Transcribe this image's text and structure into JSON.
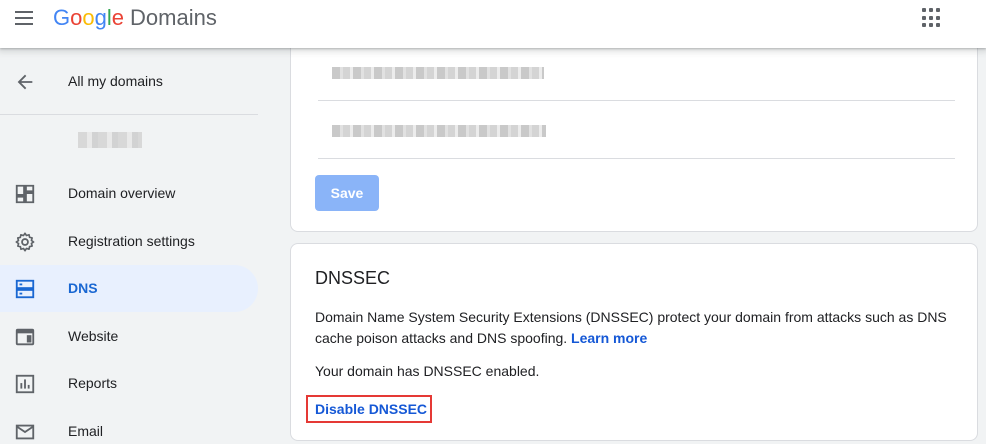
{
  "header": {
    "logo_parts": [
      "G",
      "o",
      "o",
      "g",
      "l",
      "e"
    ],
    "product": "Domains"
  },
  "sidebar": {
    "back_label": "All my domains",
    "items": [
      {
        "label": "Domain overview",
        "icon": "dashboard-icon",
        "active": false
      },
      {
        "label": "Registration settings",
        "icon": "gear-icon",
        "active": false
      },
      {
        "label": "DNS",
        "icon": "dns-icon",
        "active": true
      },
      {
        "label": "Website",
        "icon": "website-icon",
        "active": false
      },
      {
        "label": "Reports",
        "icon": "bar-chart-icon",
        "active": false
      },
      {
        "label": "Email",
        "icon": "mail-icon",
        "active": false
      }
    ]
  },
  "form": {
    "save_label": "Save"
  },
  "dnssec": {
    "title": "DNSSEC",
    "description": "Domain Name System Security Extensions (DNSSEC) protect your domain from attacks such as DNS cache poison attacks and DNS spoofing.",
    "learn_more": "Learn more",
    "status": "Your domain has DNSSEC enabled.",
    "disable_label": "Disable DNSSEC"
  },
  "colors": {
    "accent": "#1a73e8",
    "active_bg": "#e8f0fe",
    "highlight_box": "#e53935"
  }
}
